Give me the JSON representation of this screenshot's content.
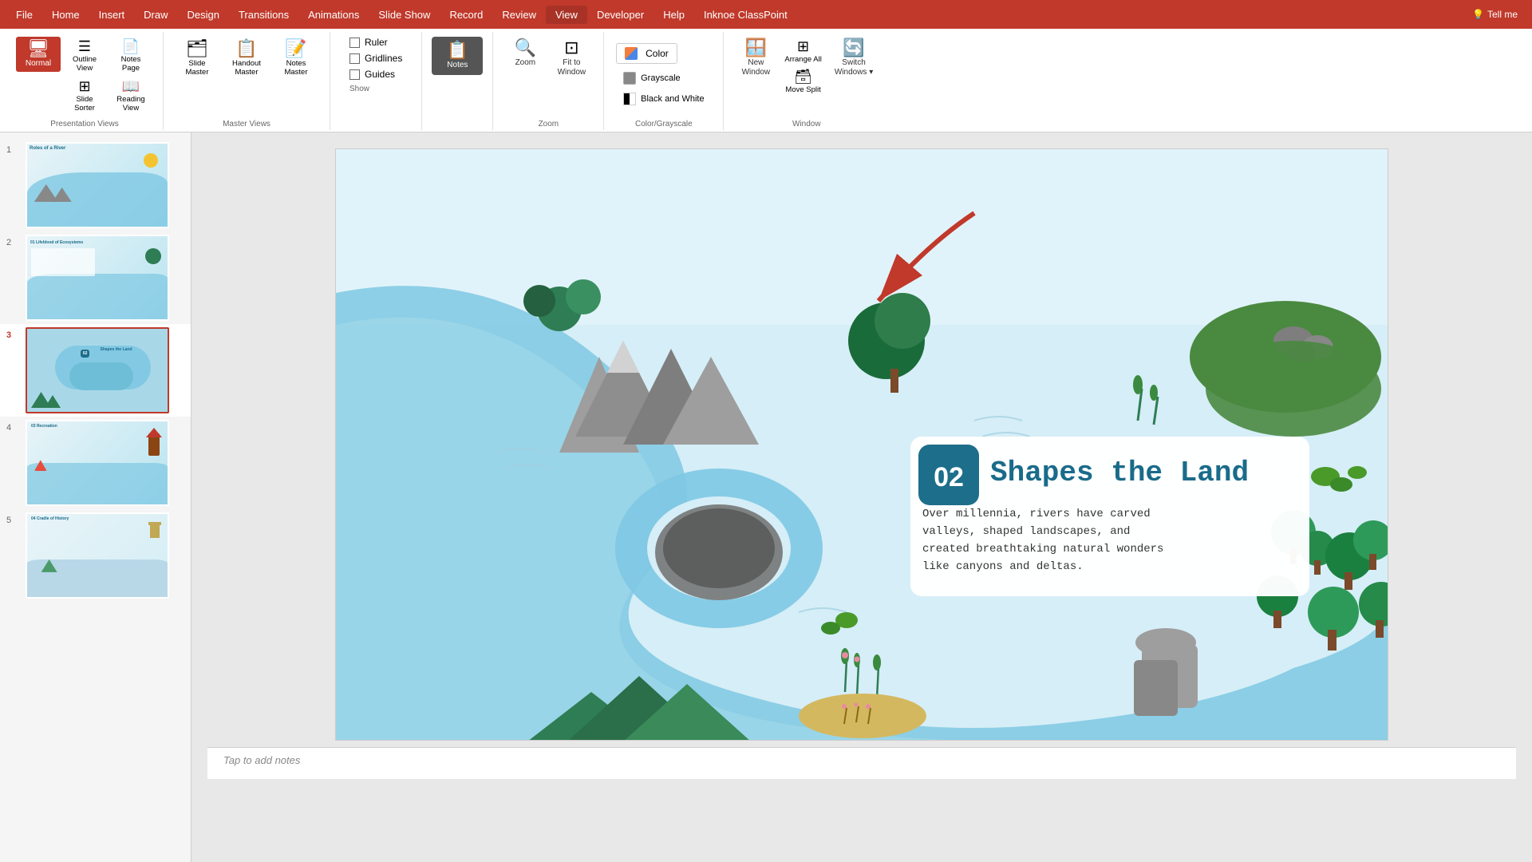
{
  "menubar": {
    "items": [
      "File",
      "Home",
      "Insert",
      "Draw",
      "Design",
      "Transitions",
      "Animations",
      "Slide Show",
      "Record",
      "Review",
      "View",
      "Developer",
      "Help",
      "Inknoe ClassPoint"
    ],
    "active_item": "View",
    "tell_me_label": "Tell me"
  },
  "ribbon": {
    "presentation_views": {
      "label": "Presentation Views",
      "buttons": [
        {
          "id": "normal",
          "icon": "🖥",
          "label": "Normal",
          "active": true
        },
        {
          "id": "outline-view",
          "icon": "☰",
          "label": "Outline\nView"
        },
        {
          "id": "slide-sorter",
          "icon": "⊞",
          "label": "Slide\nSorter"
        },
        {
          "id": "notes-page",
          "icon": "📄",
          "label": "Notes\nPage"
        },
        {
          "id": "reading-view",
          "icon": "📖",
          "label": "Reading\nView"
        }
      ]
    },
    "master_views": {
      "label": "Master Views",
      "buttons": [
        {
          "id": "slide-master",
          "icon": "🗂",
          "label": "Slide\nMaster"
        },
        {
          "id": "handout-master",
          "icon": "📋",
          "label": "Handout\nMaster"
        },
        {
          "id": "notes-master",
          "icon": "📝",
          "label": "Notes\nMaster"
        }
      ]
    },
    "show": {
      "label": "Show",
      "checkboxes": [
        {
          "id": "ruler",
          "label": "Ruler",
          "checked": false
        },
        {
          "id": "gridlines",
          "label": "Gridlines",
          "checked": false
        },
        {
          "id": "guides",
          "label": "Guides",
          "checked": false
        }
      ]
    },
    "view_toggle": {
      "label": "",
      "buttons": [
        {
          "id": "notes",
          "icon": "📋",
          "label": "Notes",
          "active": true,
          "highlighted": true
        }
      ]
    },
    "zoom": {
      "label": "Zoom",
      "buttons": [
        {
          "id": "zoom",
          "icon": "🔍",
          "label": "Zoom"
        },
        {
          "id": "fit-to-window",
          "icon": "⊡",
          "label": "Fit to\nWindow"
        }
      ]
    },
    "color_grayscale": {
      "label": "Color/Grayscale",
      "primary_label": "Color",
      "color_swatch": "#f47c3c",
      "options": [
        {
          "id": "grayscale",
          "label": "Grayscale",
          "swatch": "gray"
        },
        {
          "id": "black-and-white",
          "label": "Black and White",
          "swatch": "bw"
        }
      ]
    },
    "window": {
      "label": "Window",
      "buttons": [
        {
          "id": "new-window",
          "icon": "🪟",
          "label": "New\nWindow"
        },
        {
          "id": "arrange-all",
          "icon": "⊞",
          "label": ""
        },
        {
          "id": "switch-windows",
          "icon": "🔄",
          "label": "Switch\nWindows"
        }
      ]
    }
  },
  "slide_panel": {
    "slides": [
      {
        "number": 1,
        "title": "Roles of a River",
        "active": false
      },
      {
        "number": 2,
        "title": "Lifeblood of Ecosystems",
        "active": false
      },
      {
        "number": 3,
        "title": "Shapes the Land",
        "active": true
      },
      {
        "number": 4,
        "title": "Recreation",
        "active": false
      },
      {
        "number": 5,
        "title": "Cradle of History",
        "active": false
      }
    ]
  },
  "current_slide": {
    "number": "02",
    "heading": "Shapes the Land",
    "body": "Over millennia, rivers have carved\nvalleys, shaped landscapes, and\ncreated breathtaking natural wonders\nlike canyons and deltas."
  },
  "notes_placeholder": "Tap to add notes",
  "arrow_annotation": {
    "visible": true,
    "color": "#c0392b"
  }
}
